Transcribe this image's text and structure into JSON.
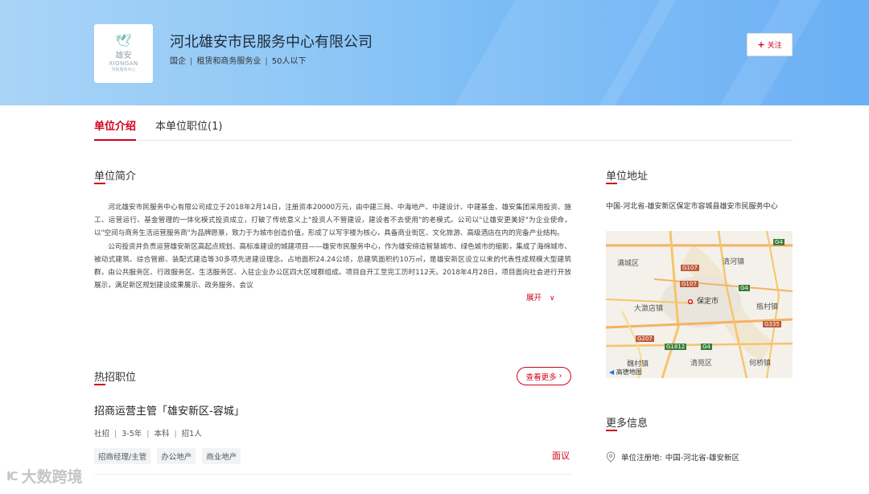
{
  "header": {
    "logo": {
      "cn": "雄安",
      "en": "XIONGAN",
      "sub": "市民服务中心"
    },
    "company_name": "河北雄安市民服务中心有限公司",
    "meta": [
      "国企",
      "租赁和商务服务业",
      "50人以下"
    ],
    "follow_label": "关注"
  },
  "tabs": [
    {
      "label": "单位介绍",
      "active": true
    },
    {
      "label": "本单位职位(1)",
      "active": false
    }
  ],
  "intro": {
    "title": "单位简介",
    "paragraphs": [
      "河北雄安市民服务中心有限公司成立于2018年2月14日，注册资本20000万元，由中建三局、中海地产、中建设计、中建基金、雄安集团采用投资、施工、运营运行、基金管理的一体化模式投资成立，打破了传统意义上\"投资人不管建设，建设者不去使用\"的老模式。公司以\"让雄安更美好\"为企业使命，以\"空间与商务生活运营服务商\"为品牌愿景，致力于为城市创造价值，形成了以写字楼为核心，具备商业街区、文化旅游、高级酒店在内的完备产业结构。",
      "公司投资并负责运营雄安新区高起点规划、高标准建设的城建项目——雄安市民服务中心，作为雄安缔造智慧城市、绿色城市的缩影，集成了海绵城市、被动式建筑、综合管廊、装配式建造等30多项先进建设理念。占地面积24.24公顷，总建筑面积约10万㎡，是雄安新区设立以来的代表性成规模大型建筑群，由公共服务区、行政服务区、生活服务区、入驻企业办公区四大区域群组成。项目自开工至完工历时112天。2018年4月28日，项目面向社会进行开放展示，满足新区规划建设成果展示、政务服务、会议"
    ],
    "expand_label": "展开"
  },
  "jobs": {
    "title": "热招职位",
    "more_label": "查看更多",
    "items": [
      {
        "title": "招商运营主管「雄安新区-容城」",
        "meta": [
          "社招",
          "3-5年",
          "本科",
          "招1人"
        ],
        "tags": [
          "招商经理/主管",
          "办公地产",
          "商业地产"
        ],
        "salary": "面议"
      }
    ]
  },
  "address": {
    "title": "单位地址",
    "text": "中国-河北省-雄安新区保定市容城县雄安市民服务中心",
    "map": {
      "labels": [
        "满城区",
        "清河镇",
        "保定市",
        "大激店镇",
        "瓶村镇",
        "魏村镇",
        "清苑区",
        "何桥镇"
      ],
      "roads": [
        "G4",
        "G107",
        "G4",
        "G107",
        "G335",
        "G207",
        "G1812",
        "G4"
      ],
      "brand": "高德地图"
    }
  },
  "more_info": {
    "title": "更多信息",
    "registered_label": "单位注册地:",
    "registered_value": "中国-河北省-雄安新区"
  },
  "watermark": {
    "icon": "IC",
    "text": "大数跨境"
  }
}
